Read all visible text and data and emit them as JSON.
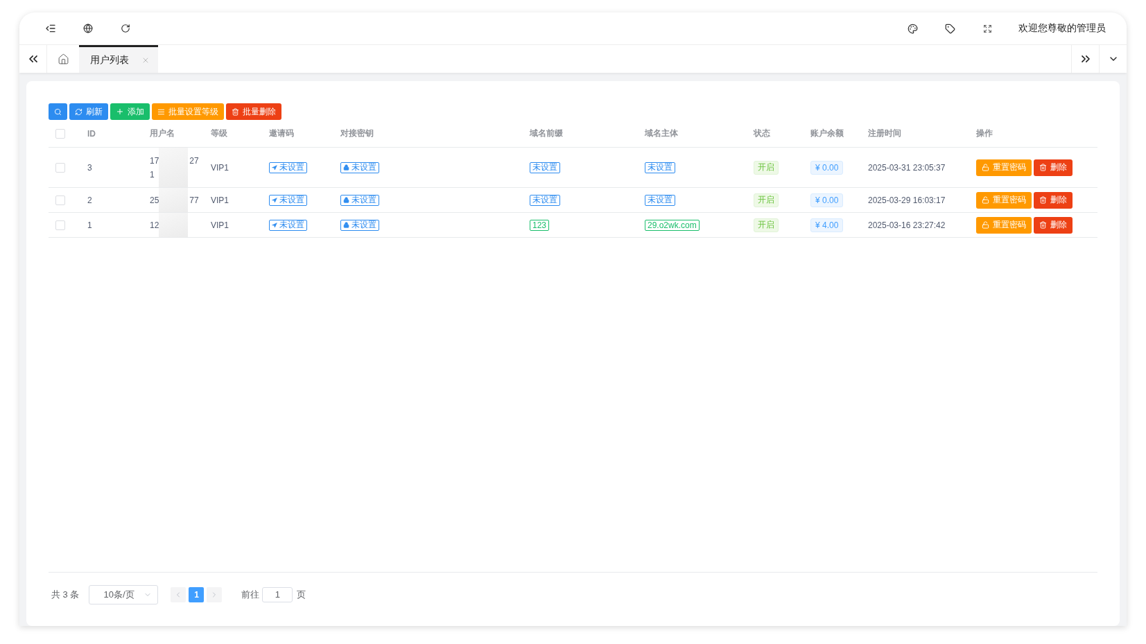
{
  "header": {
    "welcome": "欢迎您尊敬的管理员"
  },
  "tabs": [
    {
      "label": "用户列表",
      "selected": true
    }
  ],
  "toolbar": [
    {
      "kind": "search"
    },
    {
      "kind": "refresh",
      "label": "刷新"
    },
    {
      "kind": "add",
      "label": "添加"
    },
    {
      "kind": "level",
      "label": "批量设置等级"
    },
    {
      "kind": "delete",
      "label": "批量删除"
    }
  ],
  "table": {
    "select_all_checked": false,
    "columns": [
      "ID",
      "用户名",
      "等级",
      "邀请码",
      "对接密钥",
      "域名前缀",
      "域名主体",
      "状态",
      "账户余额",
      "注册时间",
      "操作"
    ],
    "rows": [
      {
        "checked": false,
        "id": "3",
        "username_lines": [
          [
            "17",
            "27"
          ],
          [
            "1"
          ]
        ],
        "level": "VIP1",
        "invite": "未设置",
        "key": "未设置",
        "prefix": {
          "text": "未设置",
          "color": "#2d8cf0"
        },
        "subject": {
          "text": "未设置",
          "color": "#2d8cf0"
        },
        "status": "开启",
        "balance": "¥ 0.00",
        "time": "2025-03-31 23:05:37",
        "actions": [
          "重置密码",
          "删除"
        ]
      },
      {
        "checked": false,
        "id": "2",
        "username_lines": [
          [
            "25",
            "77"
          ]
        ],
        "level": "VIP1",
        "invite": "未设置",
        "key": "未设置",
        "prefix": {
          "text": "未设置",
          "color": "#2d8cf0"
        },
        "subject": {
          "text": "未设置",
          "color": "#2d8cf0"
        },
        "status": "开启",
        "balance": "¥ 0.00",
        "time": "2025-03-29 16:03:17",
        "actions": [
          "重置密码",
          "删除"
        ]
      },
      {
        "checked": false,
        "id": "1",
        "username_lines": [
          [
            "12"
          ]
        ],
        "level": "VIP1",
        "invite": "未设置",
        "key": "未设置",
        "prefix": {
          "text": "123",
          "color": "#19be6b"
        },
        "subject": {
          "text": "29.o2wk.com",
          "color": "#19be6b"
        },
        "status": "开启",
        "balance": "¥ 4.00",
        "time": "2025-03-16 23:27:42",
        "actions": [
          "重置密码",
          "删除"
        ]
      }
    ]
  },
  "pagination": {
    "total": "共 3 条",
    "page_size": "10条/页",
    "pages": [
      {
        "label": "1",
        "selected": true
      }
    ],
    "goto_label": "前往",
    "goto_value": "1",
    "goto_suffix": "页"
  }
}
